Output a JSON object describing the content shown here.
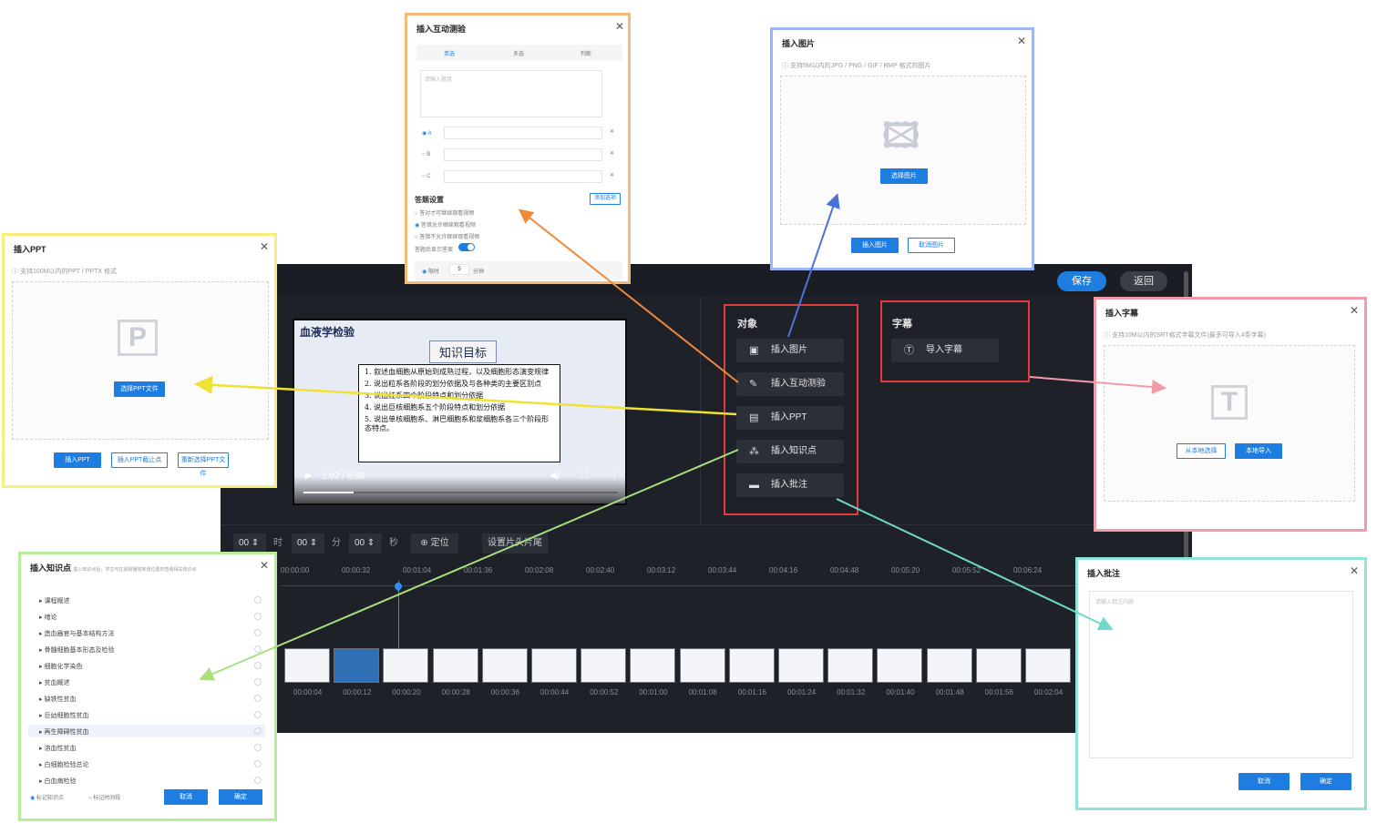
{
  "editor": {
    "save_label": "保存",
    "back_label": "返回",
    "video": {
      "title": "血液学检验",
      "badge": "知识目标",
      "lines": [
        "1.  叙述血细胞从原始到成熟过程，以及细胞形态演变规律",
        "2.  说出粒系各阶段的划分依据及与各种类的主要区别点",
        "3.  说出红系四个阶段特点和划分依据",
        "4.  说出巨核细胞系五个阶段特点和划分依据",
        "5.  说出单核细胞系、淋巴细胞系和浆细胞系各三个阶段形态特点。"
      ],
      "time": "1:02 / 6:58",
      "progress": 0.16
    },
    "object_panel": {
      "title": "对象",
      "buttons": [
        {
          "icon": "image-icon",
          "glyph": "▣",
          "label": "插入图片"
        },
        {
          "icon": "quiz-icon",
          "glyph": "✎",
          "label": "插入互动测验"
        },
        {
          "icon": "ppt-icon",
          "glyph": "▤",
          "label": "插入PPT"
        },
        {
          "icon": "knowledge-icon",
          "glyph": "⁂",
          "label": "插入知识点"
        },
        {
          "icon": "comment-icon",
          "glyph": "▬",
          "label": "插入批注"
        }
      ]
    },
    "subtitle_panel": {
      "title": "字幕",
      "button": {
        "icon": "text-icon",
        "glyph": "Ⓣ",
        "label": "导入字幕"
      }
    },
    "timebar": {
      "hour": "00",
      "hour_unit": "时",
      "minute": "00",
      "minute_unit": "分",
      "second": "00",
      "second_unit": "秒",
      "locate_label": "⊕ 定位",
      "set_label": "设置片头片尾"
    },
    "ruler_labels": [
      "00:00:00",
      "00:00:32",
      "00:01:04",
      "00:01:36",
      "00:02:08",
      "00:02:40",
      "00:03:12",
      "00:03:44",
      "00:04:16",
      "00:04:48",
      "00:05:20",
      "00:05:52",
      "00:06:24"
    ],
    "thumb_labels": [
      "00:00:04",
      "00:00:12",
      "00:00:20",
      "00:00:28",
      "00:00:36",
      "00:00:44",
      "00:00:52",
      "00:01:00",
      "00:01:08",
      "00:01:16",
      "00:01:24",
      "00:01:32",
      "00:01:40",
      "00:01:48",
      "00:01:56",
      "00:02:04"
    ]
  },
  "dialogs": {
    "quiz": {
      "title": "插入互动测验",
      "tabs": [
        "单选",
        "多选",
        "判断"
      ],
      "question_placeholder": "请输入题目",
      "options": [
        "A",
        "B",
        "C"
      ],
      "settings_title": "答题设置",
      "add_option": "添加选项",
      "setting_items": [
        "答对才可继续观看视频",
        "答错允许继续观看视频",
        "答错不允许继续观看视频"
      ],
      "show_answer": "答题后显示答案",
      "duration_value": "5",
      "duration_unit": "分钟",
      "duration_prefix": "限时"
    },
    "image": {
      "title": "插入图片",
      "hint": "支持5M以内的JPG / PNG / GIF / BMP 格式的图片",
      "select_label": "选择图片",
      "insert_label": "插入图片",
      "cancel_label": "取消图片"
    },
    "ppt": {
      "title": "插入PPT",
      "hint": "支持100M以内的PPT / PPTX 格式",
      "select_label": "选择PPT文件",
      "insert_label": "插入PPT",
      "insert_point_label": "插入PPT截止点",
      "reselect_label": "重新选择PPT文件"
    },
    "subtitle": {
      "title": "插入字幕",
      "hint": "支持10M以内的SRT格式字幕文件(最多可导入4条字幕)",
      "local_label": "从本地选择",
      "import_label": "本地导入"
    },
    "knowledge": {
      "title": "插入知识点",
      "subtitle": "插入知识点后，学生可在视频播放到该位置时查看相关知识点",
      "items": [
        "课程概述",
        "绪论",
        "造血器官与基本结构方法",
        "骨髓细胞基本形态及检验",
        "细胞化学染色",
        "贫血概述",
        "缺铁性贫血",
        "巨幼细胞性贫血",
        "再生障碍性贫血",
        "溶血性贫血",
        "白细胞检验总论",
        "白血病检验"
      ],
      "footer_options": [
        "标记知识点",
        "标记时间段"
      ],
      "cancel_label": "取消",
      "ok_label": "确定"
    },
    "comment": {
      "title": "插入批注",
      "placeholder": "请输入批注内容",
      "cancel_label": "取消",
      "ok_label": "确定"
    }
  },
  "colors": {
    "accent": "#1e7de0",
    "editor_bg": "#1e2128",
    "ppt_frame": "#f7ef7a",
    "quiz_frame": "#f5b978",
    "image_frame": "#9db5f5",
    "subtitle_frame": "#f19aa8",
    "knowledge_frame": "#b7ec9a",
    "comment_frame": "#8fe6d8",
    "highlight": "#e23b3b"
  }
}
